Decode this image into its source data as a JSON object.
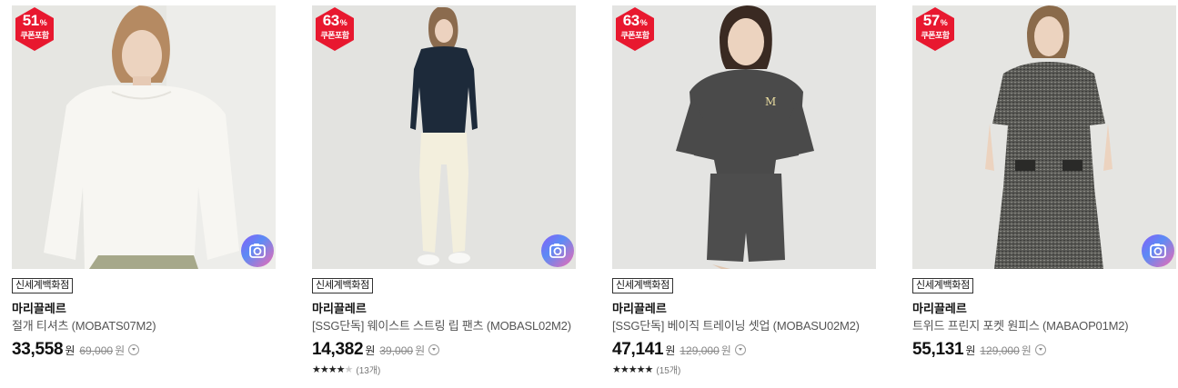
{
  "products": [
    {
      "discount": "51",
      "discount_unit": "%",
      "coupon": "쿠폰포함",
      "shop": "신세계백화점",
      "brand": "마리끌레르",
      "name": "절개 티셔츠 (MOBATS07M2)",
      "price": "33,558",
      "won": "원",
      "original_price": "69,000",
      "original_won": "원",
      "rating": null,
      "review_count": null
    },
    {
      "discount": "63",
      "discount_unit": "%",
      "coupon": "쿠폰포함",
      "shop": "신세계백화점",
      "brand": "마리끌레르",
      "name": "[SSG단독] 웨이스트 스트링 립 팬츠 (MOBASL02M2)",
      "price": "14,382",
      "won": "원",
      "original_price": "39,000",
      "original_won": "원",
      "rating": 4,
      "review_count": "(13개)"
    },
    {
      "discount": "63",
      "discount_unit": "%",
      "coupon": "쿠폰포함",
      "shop": "신세계백화점",
      "brand": "마리끌레르",
      "name": "[SSG단독] 베이직 트레이닝 셋업 (MOBASU02M2)",
      "price": "47,141",
      "won": "원",
      "original_price": "129,000",
      "original_won": "원",
      "rating": 5,
      "review_count": "(15개)"
    },
    {
      "discount": "57",
      "discount_unit": "%",
      "coupon": "쿠폰포함",
      "shop": "신세계백화점",
      "brand": "마리끌레르",
      "name": "트위드 프린지 포켓 원피스 (MABAOP01M2)",
      "price": "55,131",
      "won": "원",
      "original_price": "129,000",
      "original_won": "원",
      "rating": null,
      "review_count": null
    }
  ],
  "colors": {
    "badge": "#e8182f",
    "photo_bg": "#e6e6e4"
  },
  "icons": {
    "camera": "camera-icon",
    "info": "info-circle-icon",
    "star": "star-icon"
  }
}
